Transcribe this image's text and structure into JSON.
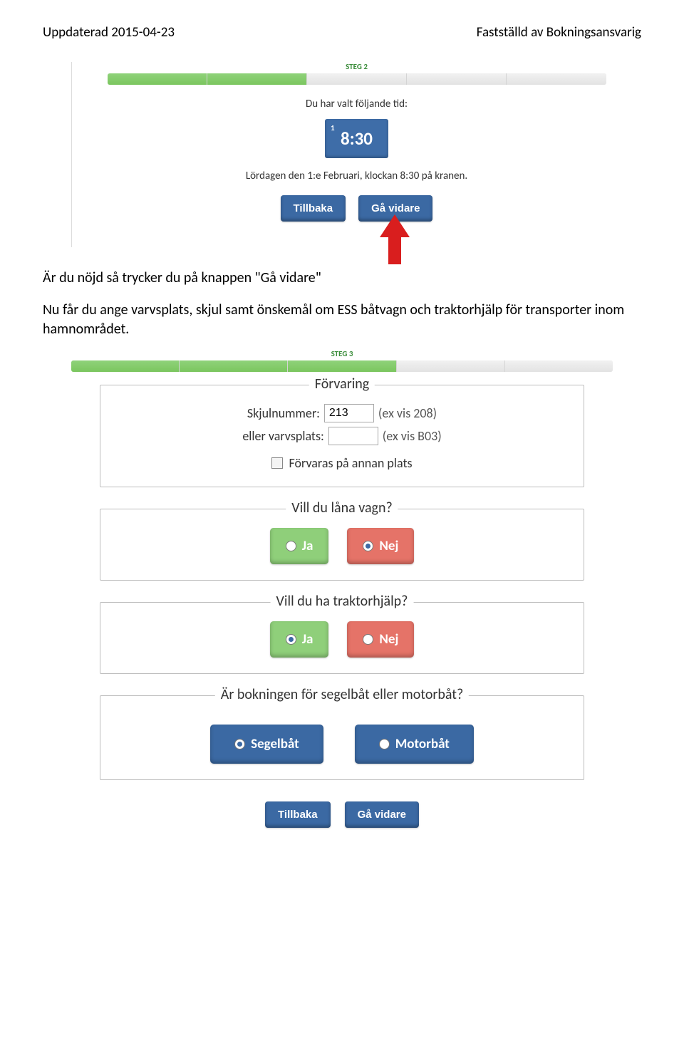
{
  "header": {
    "left": "Uppdaterad 2015-04-23",
    "right": "Fastställd av Bokningsansvarig"
  },
  "step2": {
    "label": "STEG 2",
    "chosen_text": "Du har valt följande tid:",
    "time_badge": "1",
    "time": "8:30",
    "date_line": "Lördagen den 1:e Februari, klockan 8:30 på kranen.",
    "back": "Tillbaka",
    "next": "Gå vidare"
  },
  "body_text_1": "Är du nöjd så trycker du på knappen \"Gå vidare\"",
  "body_text_2": "Nu får du ange varvsplats, skjul samt önskemål om ESS båtvagn och traktorhjälp för transporter inom hamnområdet.",
  "step3": {
    "label": "STEG 3",
    "storage": {
      "legend": "Förvaring",
      "skjul_label": "Skjulnummer:",
      "skjul_value": "213",
      "skjul_hint": "(ex vis 208)",
      "varv_label": "eller varvsplats:",
      "varv_value": "",
      "varv_hint": "(ex vis B03)",
      "annan": "Förvaras på annan plats"
    },
    "wagon": {
      "legend": "Vill du låna vagn?",
      "ja": "Ja",
      "nej": "Nej",
      "selected": "nej"
    },
    "tractor": {
      "legend": "Vill du ha traktorhjälp?",
      "ja": "Ja",
      "nej": "Nej",
      "selected": "ja"
    },
    "boat": {
      "legend": "Är bokningen för segelbåt eller motorbåt?",
      "segel": "Segelbåt",
      "motor": "Motorbåt",
      "selected": "segel"
    },
    "back": "Tillbaka",
    "next": "Gå vidare"
  }
}
